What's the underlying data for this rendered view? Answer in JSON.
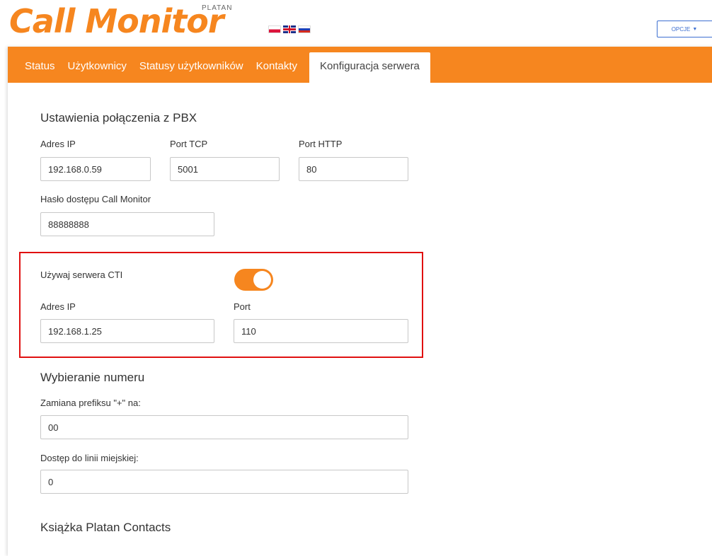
{
  "header": {
    "logo_text": "Call Monitor",
    "logo_brand": "PLATAN",
    "flags": [
      "flag-pl-icon",
      "flag-uk-icon",
      "flag-ru-icon"
    ],
    "options_label": "OPCJE",
    "accent_color": "#f6861f"
  },
  "nav": {
    "tabs": [
      "Status",
      "Użytkownicy",
      "Statusy użytkowników",
      "Kontakty",
      "Konfiguracja serwera"
    ],
    "active": "Konfiguracja serwera"
  },
  "pbx": {
    "title": "Ustawienia połączenia z PBX",
    "ip_label": "Adres IP",
    "ip_value": "192.168.0.59",
    "tcp_label": "Port TCP",
    "tcp_value": "5001",
    "http_label": "Port HTTP",
    "http_value": "80",
    "password_label": "Hasło dostępu Call Monitor",
    "password_value": "88888888"
  },
  "cti": {
    "use_label": "Używaj serwera CTI",
    "enabled": true,
    "ip_label": "Adres IP",
    "ip_value": "192.168.1.25",
    "port_label": "Port",
    "port_value": "110"
  },
  "dialing": {
    "title": "Wybieranie numeru",
    "prefix_label": "Zamiana prefiksu \"+\" na:",
    "prefix_value": "00",
    "line_label": "Dostęp do linii miejskiej:",
    "line_value": "0"
  },
  "contacts": {
    "title": "Książka Platan Contacts"
  }
}
